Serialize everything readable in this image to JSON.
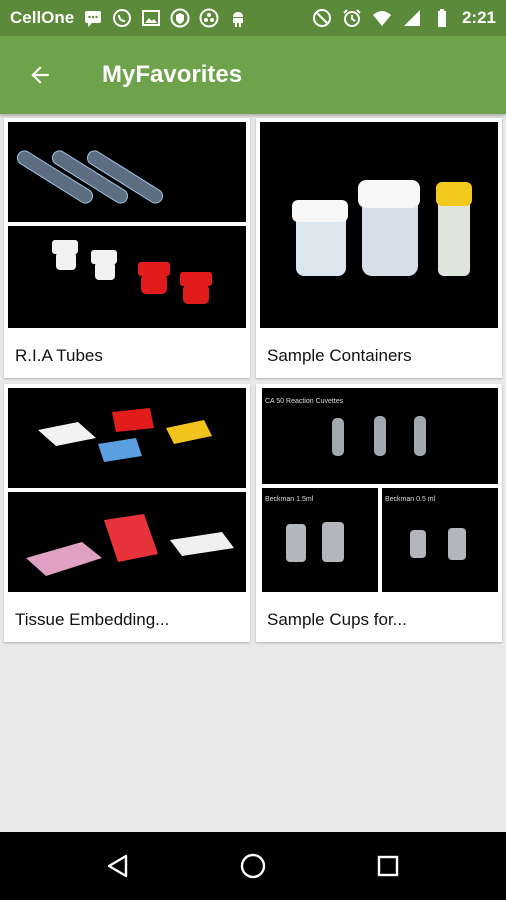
{
  "status_bar": {
    "carrier": "CellOne",
    "time": "2:21",
    "icons": [
      "message-icon",
      "whatsapp-icon",
      "image-icon",
      "shield-icon",
      "app-icon",
      "android-icon",
      "no-sim-icon",
      "alarm-icon",
      "wifi-icon",
      "signal-icon",
      "battery-icon"
    ]
  },
  "app_bar": {
    "title": "MyFavorites",
    "back_icon": "arrow-back-icon"
  },
  "favorites": [
    {
      "label": "R.I.A Tubes"
    },
    {
      "label": "Sample Containers"
    },
    {
      "label": "Tissue Embedding..."
    },
    {
      "label": "Sample Cups for..."
    }
  ],
  "image_labels": {
    "cuvettes": "CA 50 Reaction Cuvettes",
    "beckman_15": "Beckman 1.5ml",
    "beckman_05": "Beckman 0.5 ml"
  },
  "nav_bar": {
    "icons": [
      "back-triangle-icon",
      "home-circle-icon",
      "recents-square-icon"
    ]
  },
  "colors": {
    "status_bar": "#5a8a3a",
    "app_bar": "#6fa34b",
    "background": "#e9e9e9"
  }
}
